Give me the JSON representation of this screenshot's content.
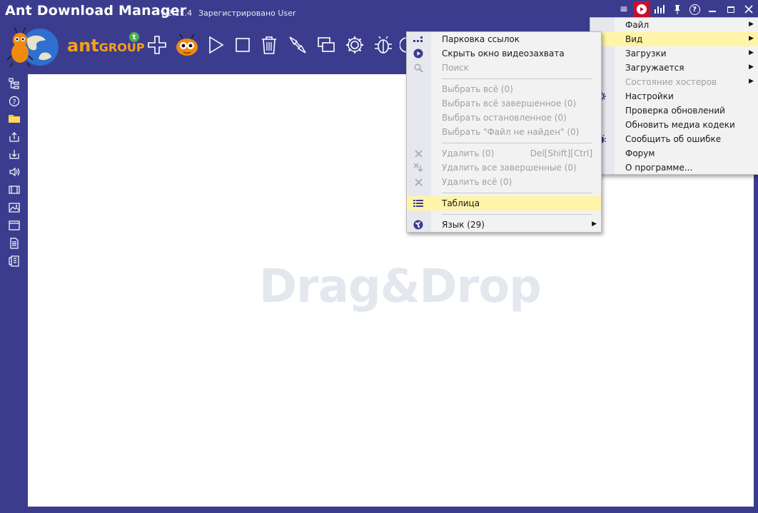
{
  "window": {
    "title": "Ant Download Manager",
    "version": "v.2.11.4",
    "registration": "Зарегистрировано User"
  },
  "titlebar_buttons": {
    "menu": "≡",
    "record": "▶",
    "equalizer": "▥",
    "pin": "⊥",
    "help": "?",
    "minimize": "—",
    "maximize": "▫",
    "close": "✕"
  },
  "toolbar": {
    "brand": "ant",
    "brand_group": "GROUP",
    "brand_badge": "t"
  },
  "canvas": {
    "placeholder": "Drag&Drop"
  },
  "main_menu": {
    "items": [
      {
        "label": "Файл",
        "submenu": true,
        "enabled": true
      },
      {
        "label": "Вид",
        "submenu": true,
        "enabled": true,
        "highlighted": true
      },
      {
        "label": "Загрузки",
        "submenu": true,
        "enabled": true
      },
      {
        "label": "Загружается",
        "submenu": true,
        "enabled": true
      },
      {
        "label": "Состояние хостеров",
        "submenu": true,
        "enabled": false
      },
      {
        "label": "Настройки",
        "submenu": false,
        "enabled": true
      },
      {
        "label": "Проверка обновлений",
        "submenu": false,
        "enabled": true
      },
      {
        "label": "Обновить медиа кодеки",
        "submenu": false,
        "enabled": true
      },
      {
        "label": "Сообщить об ошибке",
        "submenu": false,
        "enabled": true
      },
      {
        "label": "Форум",
        "submenu": false,
        "enabled": true
      },
      {
        "label": "О программе...",
        "submenu": false,
        "enabled": true
      }
    ]
  },
  "view_menu": {
    "items": [
      {
        "label": "Парковка ссылок",
        "icon": "link-parking-icon",
        "enabled": true
      },
      {
        "label": "Скрыть окно видеозахвата",
        "icon": "play-circle-icon",
        "enabled": true
      },
      {
        "label": "Поиск",
        "icon": "search-icon",
        "enabled": false
      },
      {
        "label": "Выбрать всё (0)",
        "enabled": false
      },
      {
        "label": "Выбрать всё завершенное (0)",
        "enabled": false
      },
      {
        "label": "Выбрать остановленное (0)",
        "enabled": false
      },
      {
        "label": "Выбрать \"Файл не найден\" (0)",
        "enabled": false
      },
      {
        "label": "Удалить (0)",
        "shortcut": "Del[Shift][Ctrl]",
        "icon": "delete-icon",
        "enabled": false
      },
      {
        "label": "Удалить все завершенные (0)",
        "icon": "delete-completed-icon",
        "enabled": false
      },
      {
        "label": "Удалить всё (0)",
        "icon": "delete-all-icon",
        "enabled": false
      },
      {
        "label": "Таблица",
        "icon": "table-icon",
        "enabled": true,
        "highlighted": true
      },
      {
        "label": "Язык (29)",
        "icon": "globe-icon",
        "enabled": true,
        "submenu": true
      }
    ]
  },
  "colors": {
    "chrome": "#3c3c8f",
    "highlight": "#fff4a8",
    "record_active": "#c8102e",
    "brand_orange": "#f4a11a"
  }
}
